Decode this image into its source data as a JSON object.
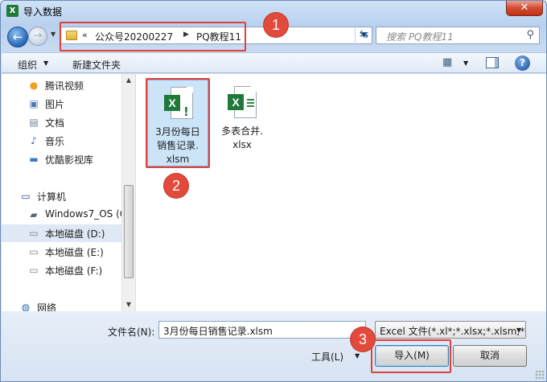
{
  "window": {
    "title": "导入数据",
    "app_icon": "X"
  },
  "address": {
    "prefix": "«",
    "segments": [
      "公众号20200227",
      "PQ教程11"
    ]
  },
  "search": {
    "placeholder": "搜索 PQ教程11"
  },
  "toolbar": {
    "organize": "组织",
    "new_folder": "新建文件夹",
    "help": "?"
  },
  "nav": {
    "favorites": [
      {
        "label": "腾讯视频",
        "icon": "video-icon"
      },
      {
        "label": "图片",
        "icon": "pictures-icon"
      },
      {
        "label": "文档",
        "icon": "documents-icon"
      },
      {
        "label": "音乐",
        "icon": "music-icon"
      },
      {
        "label": "优酷影视库",
        "icon": "youku-library-icon"
      }
    ],
    "computer": {
      "label": "计算机"
    },
    "drives": [
      {
        "label": "Windows7_OS (C"
      },
      {
        "label": "本地磁盘 (D:)"
      },
      {
        "label": "本地磁盘 (E:)"
      },
      {
        "label": "本地磁盘 (F:)"
      }
    ],
    "network": {
      "label": "网络"
    }
  },
  "files": [
    {
      "name_line1": "3月份每日",
      "name_line2": "销售记录.",
      "name_line3": "xlsm",
      "type": "xlsm"
    },
    {
      "name_line1": "多表合并.",
      "name_line2": "xlsx",
      "name_line3": "",
      "type": "xlsx"
    }
  ],
  "footer": {
    "filename_label": "文件名(N):",
    "filename_value": "3月份每日销售记录.xlsm",
    "filter_value": "Excel 文件(*.xl*;*.xlsx;*.xlsm;*.",
    "tools_label": "工具(L)",
    "import_label": "导入(M)",
    "cancel_label": "取消"
  },
  "annotations": [
    "1",
    "2",
    "3"
  ],
  "colors": {
    "annotation": "#e0413a",
    "excel_green": "#1f7a3a",
    "selection": "#cce4f7"
  }
}
